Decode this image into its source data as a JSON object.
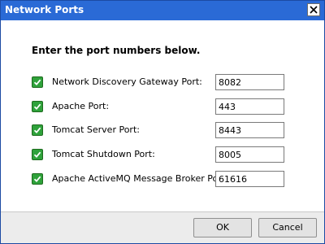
{
  "window": {
    "title": "Network Ports",
    "title_bar_color": "#2a6ad6"
  },
  "heading": "Enter the port numbers below.",
  "ports": [
    {
      "label": "Network Discovery Gateway Port:",
      "value": "8082",
      "checked": true
    },
    {
      "label": "Apache Port:",
      "value": "443",
      "checked": true
    },
    {
      "label": "Tomcat Server Port:",
      "value": "8443",
      "checked": true
    },
    {
      "label": "Tomcat Shutdown Port:",
      "value": "8005",
      "checked": true
    },
    {
      "label": "Apache ActiveMQ Message Broker Port:",
      "value": "61616",
      "checked": true
    }
  ],
  "buttons": {
    "ok_label": "OK",
    "cancel_label": "Cancel"
  },
  "icons": {
    "close": "close-icon",
    "checkbox": "checkmark-icon"
  },
  "colors": {
    "checkbox_fill": "#2fa23b"
  }
}
